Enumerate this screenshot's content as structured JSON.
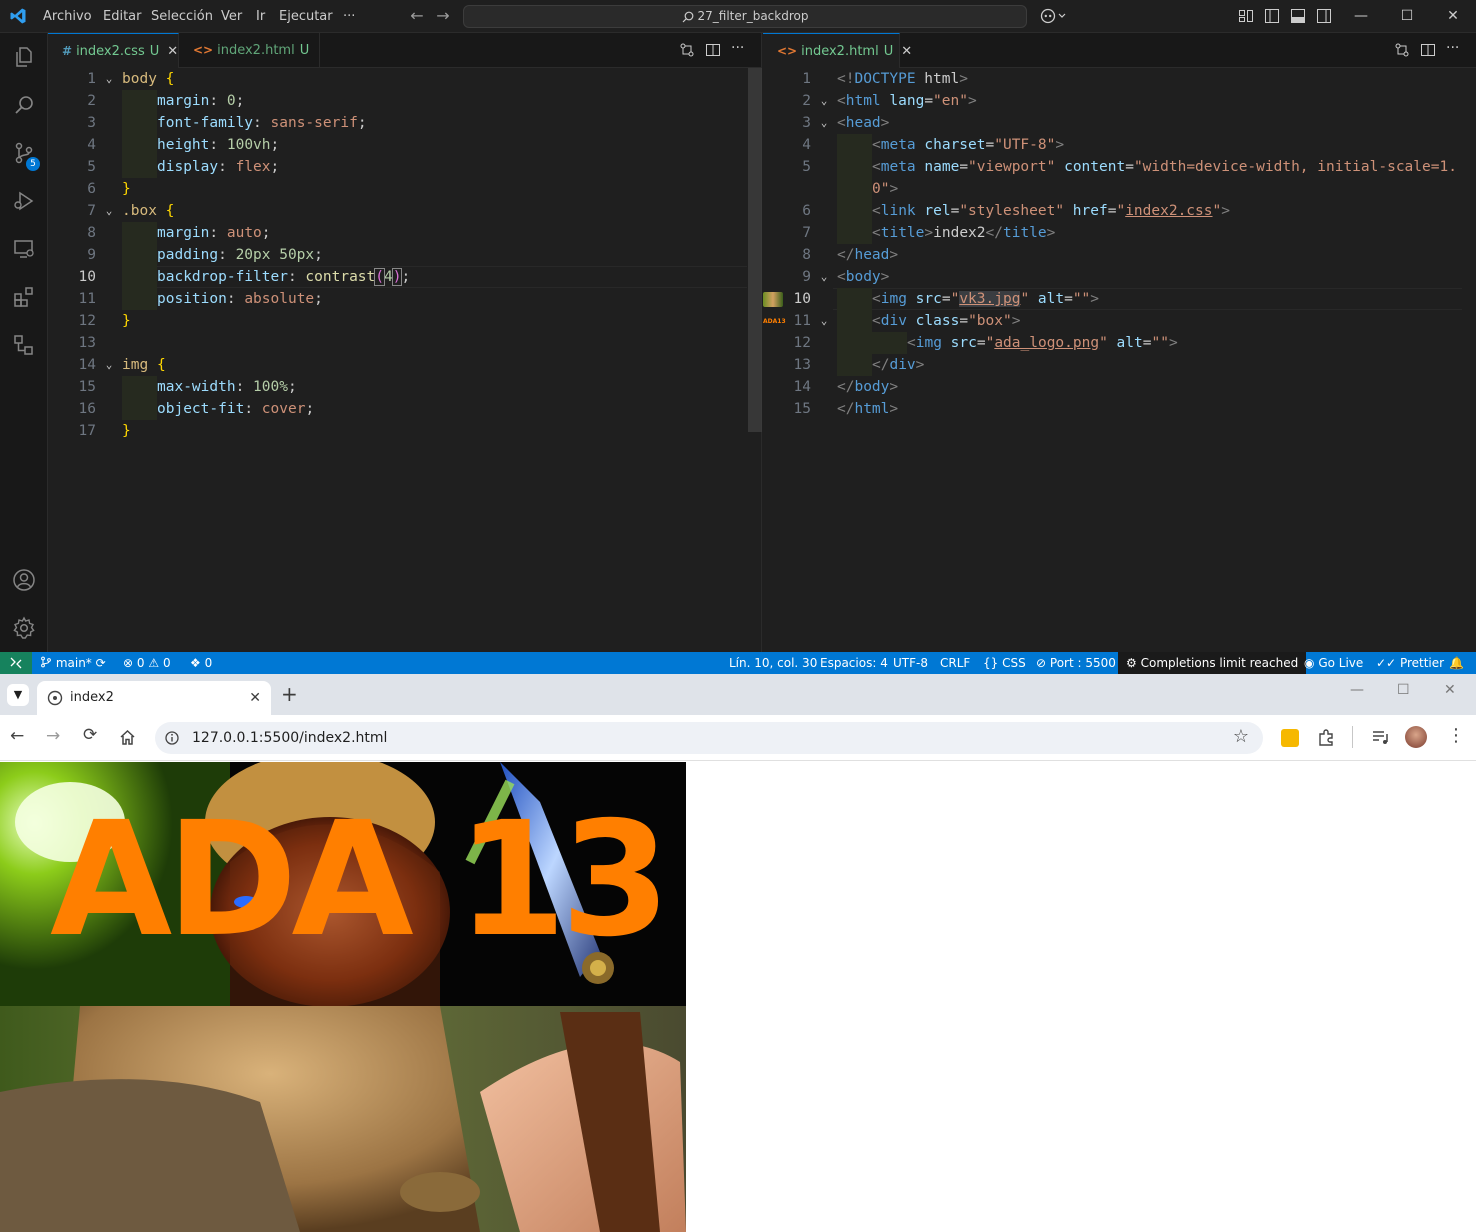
{
  "titlebar": {
    "menu": [
      "Archivo",
      "Editar",
      "Selección",
      "Ver",
      "Ir",
      "Ejecutar",
      "···"
    ],
    "search": "27_filter_backdrop"
  },
  "activity": {
    "scm_badge": "5"
  },
  "left_group": {
    "tabs": [
      {
        "icon": "#",
        "name": "index2.css",
        "status": "U",
        "close": "✕"
      },
      {
        "icon": "<>",
        "name": "index2.html",
        "status": "U"
      }
    ],
    "lines": [
      {
        "n": "1"
      },
      {
        "n": "2"
      },
      {
        "n": "3"
      },
      {
        "n": "4"
      },
      {
        "n": "5"
      },
      {
        "n": "6"
      },
      {
        "n": "7"
      },
      {
        "n": "8"
      },
      {
        "n": "9"
      },
      {
        "n": "10"
      },
      {
        "n": "11"
      },
      {
        "n": "12"
      },
      {
        "n": "13"
      },
      {
        "n": "14"
      },
      {
        "n": "15"
      },
      {
        "n": "16"
      },
      {
        "n": "17"
      }
    ],
    "code": {
      "l1": [
        "body",
        "{"
      ],
      "l2": [
        "margin",
        ": ",
        "0",
        ";"
      ],
      "l3": [
        "font-family",
        ": ",
        "sans-serif",
        ";"
      ],
      "l4": [
        "height",
        ": ",
        "100vh",
        ";"
      ],
      "l5": [
        "display",
        ": ",
        "flex",
        ";"
      ],
      "l6": [
        "}"
      ],
      "l7": [
        ".box",
        "{"
      ],
      "l8": [
        "margin",
        ": ",
        "auto",
        ";"
      ],
      "l9": [
        "padding",
        ": ",
        "20px 50px",
        ";"
      ],
      "l10": [
        "backdrop-filter",
        ": ",
        "contrast",
        "(",
        "4",
        ")",
        ";"
      ],
      "l11": [
        "position",
        ": ",
        "absolute",
        ";"
      ],
      "l12": [
        "}"
      ],
      "l14": [
        "img",
        "{"
      ],
      "l15": [
        "max-width",
        ": ",
        "100%",
        ";"
      ],
      "l16": [
        "object-fit",
        ": ",
        "cover",
        ";"
      ],
      "l17": [
        "}"
      ]
    }
  },
  "right_group": {
    "tabs": [
      {
        "icon": "<>",
        "name": "index2.html",
        "status": "U",
        "close": "✕"
      }
    ],
    "lines": [
      {
        "n": "1"
      },
      {
        "n": "2"
      },
      {
        "n": "3"
      },
      {
        "n": "4"
      },
      {
        "n": "5"
      },
      {
        "n": ""
      },
      {
        "n": "6"
      },
      {
        "n": "7"
      },
      {
        "n": "8"
      },
      {
        "n": "9"
      },
      {
        "n": "10"
      },
      {
        "n": "11"
      },
      {
        "n": "12"
      },
      {
        "n": "13"
      },
      {
        "n": "14"
      },
      {
        "n": "15"
      }
    ],
    "code": {
      "l1": [
        "<!",
        "DOCTYPE",
        " html",
        ">"
      ],
      "l2": [
        "<",
        "html",
        " lang",
        "=",
        "\"en\"",
        ">"
      ],
      "l3": [
        "<",
        "head",
        ">"
      ],
      "l4": [
        "<",
        "meta",
        " charset",
        "=",
        "\"UTF-8\"",
        ">"
      ],
      "l5": [
        "<",
        "meta",
        " name",
        "=",
        "\"viewport\"",
        " content",
        "=",
        "\"width=device-width, initial-scale=1."
      ],
      "l5b": [
        "0\"",
        ">"
      ],
      "l6": [
        "<",
        "link",
        " rel",
        "=",
        "\"stylesheet\"",
        " href",
        "=",
        "\"",
        "index2.css",
        "\"",
        ">"
      ],
      "l7": [
        "<",
        "title",
        ">",
        "index2",
        "</",
        "title",
        ">"
      ],
      "l8": [
        "</",
        "head",
        ">"
      ],
      "l9": [
        "<",
        "body",
        ">"
      ],
      "l10": [
        "<",
        "img",
        " src",
        "=",
        "\"",
        "vk3.jpg",
        "\"",
        " alt",
        "=",
        "\"\"",
        ">"
      ],
      "l11": [
        "<",
        "div",
        " class",
        "=",
        "\"box\"",
        ">"
      ],
      "l12": [
        "<",
        "img",
        " src",
        "=",
        "\"",
        "ada_logo.png",
        "\"",
        " alt",
        "=",
        "\"\"",
        ">"
      ],
      "l13": [
        "</",
        "div",
        ">"
      ],
      "l14": [
        "</",
        "body",
        ">"
      ],
      "l15": [
        "</",
        "html",
        ">"
      ]
    },
    "glyph_label": "ADA13"
  },
  "statusbar": {
    "branch": "main*",
    "errors": "0",
    "warnings": "0",
    "ports": "0",
    "position": "Lín. 10, col. 30",
    "spaces": "Espacios: 4",
    "encoding": "UTF-8",
    "eol": "CRLF",
    "language": "CSS",
    "port": "Port : 5500",
    "copilot": "Completions limit reached",
    "golive": "Go Live",
    "prettier": "Prettier"
  },
  "browser": {
    "tab_title": "index2",
    "tab_close": "✕",
    "new_tab": "+",
    "url": "127.0.0.1:5500/index2.html",
    "logo_text": "ADA 13"
  },
  "colors": {
    "accent": "#0078d4",
    "remote": "#16825d",
    "logo_orange": "#ff7f00"
  }
}
